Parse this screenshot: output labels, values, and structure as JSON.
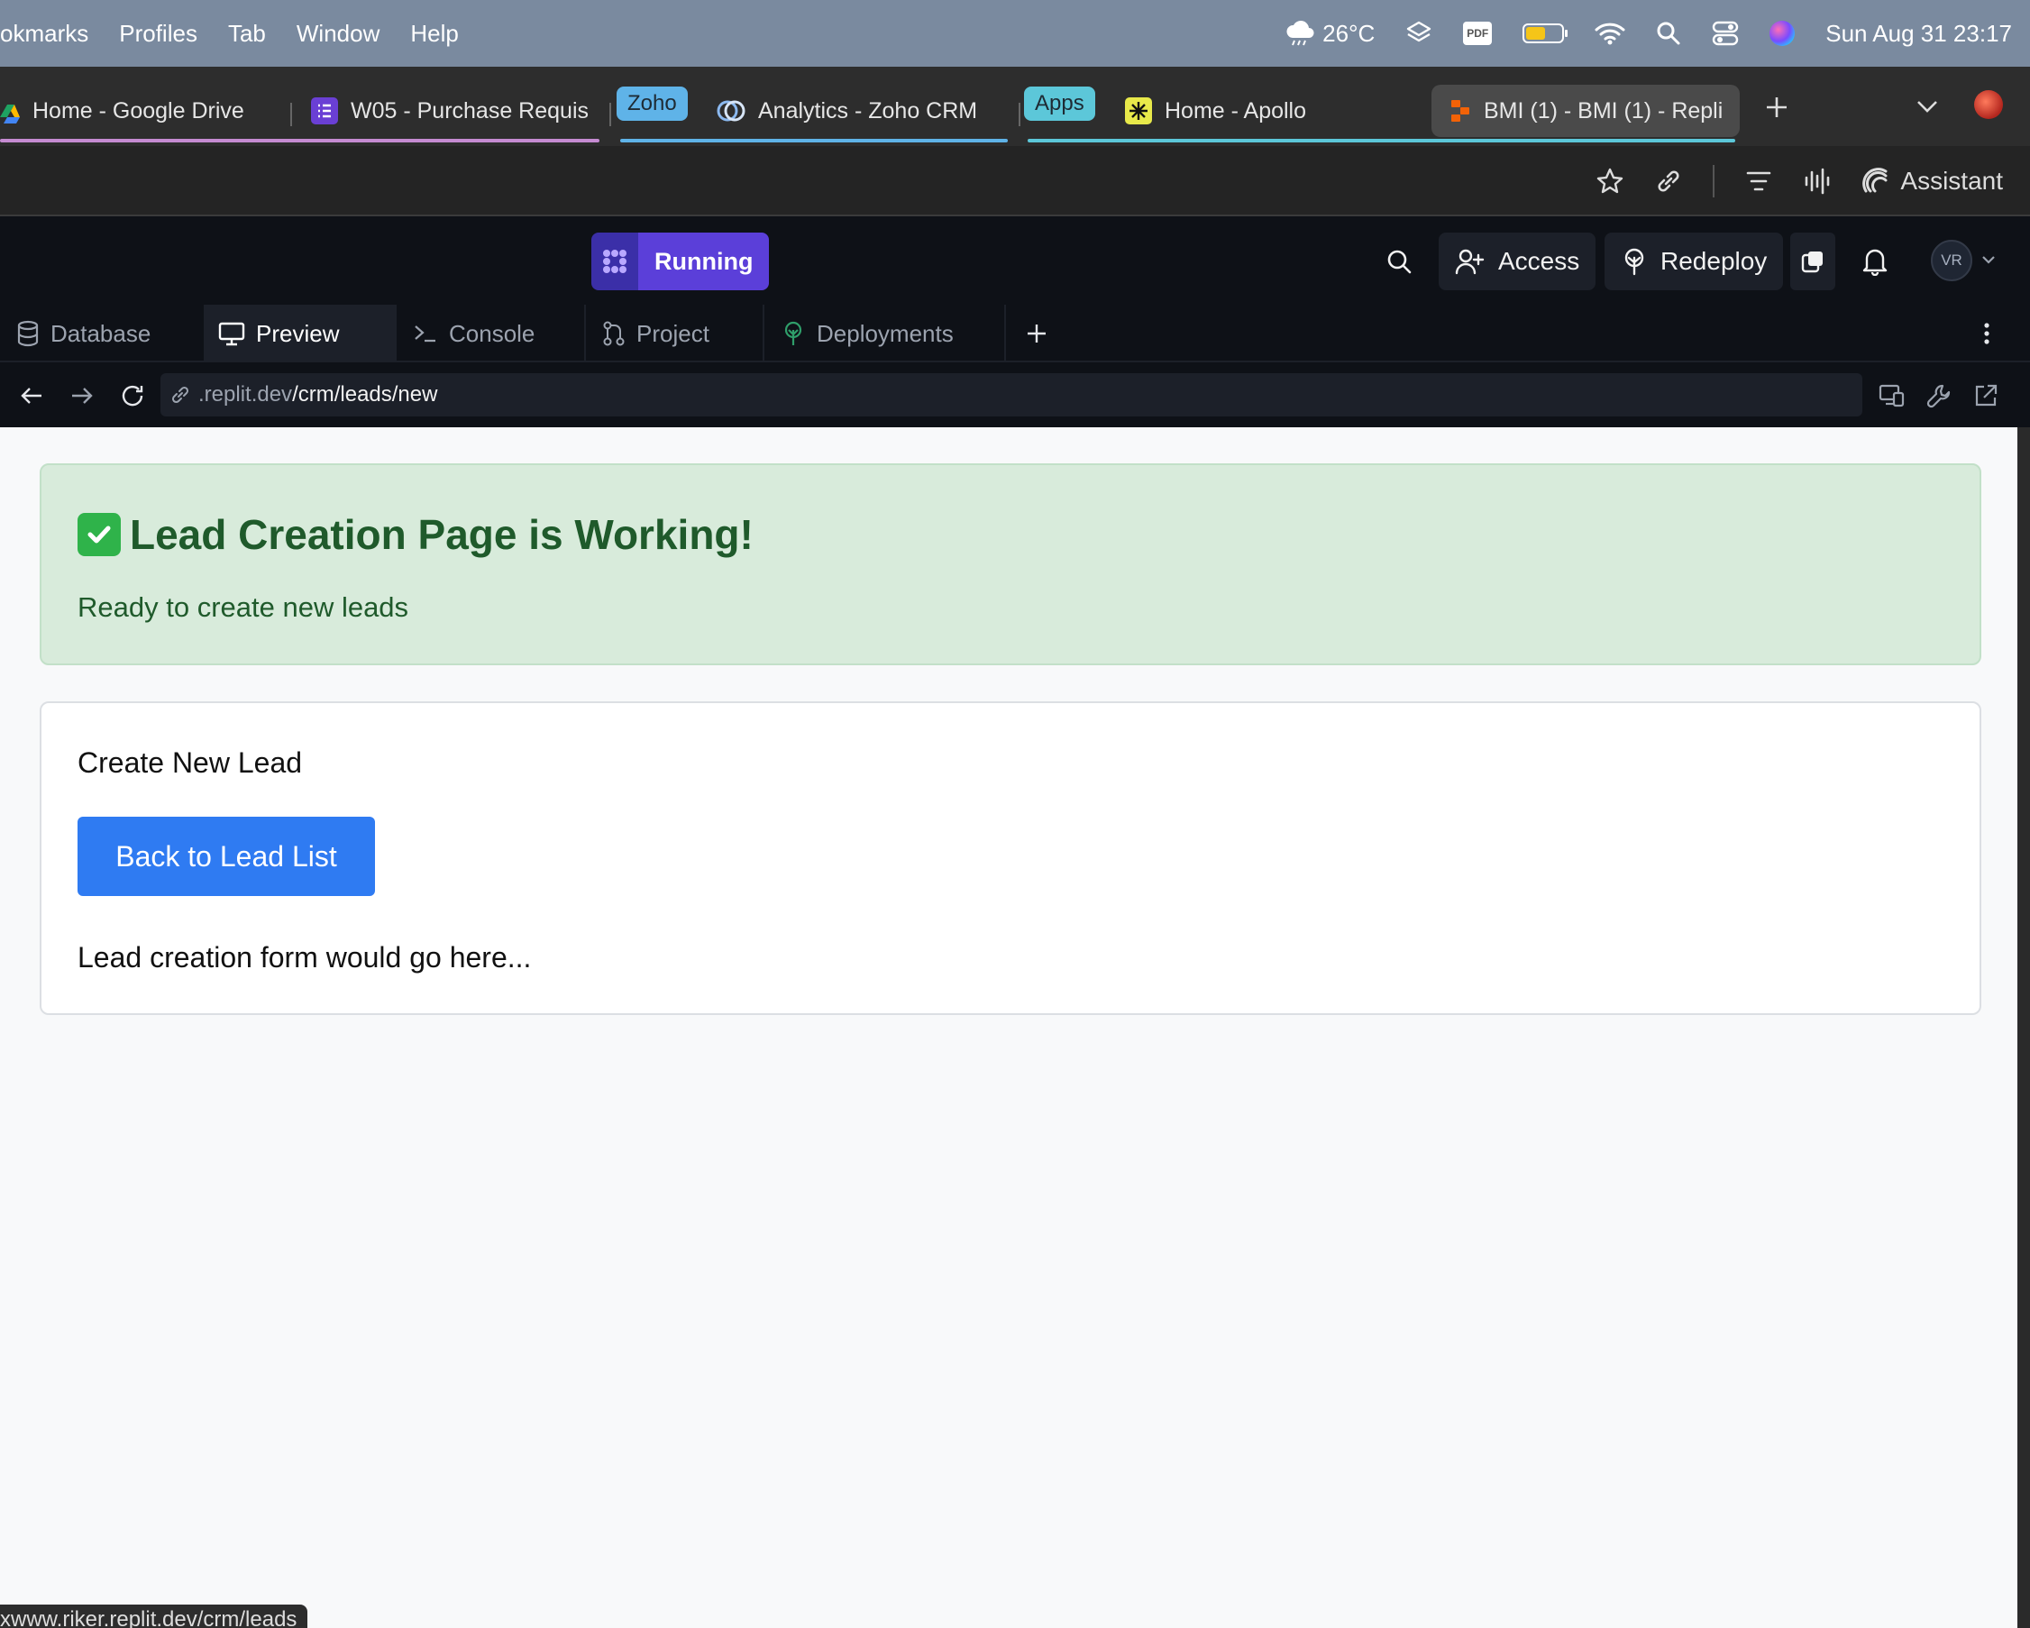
{
  "menubar": {
    "items": [
      "okmarks",
      "Profiles",
      "Tab",
      "Window",
      "Help"
    ],
    "weather": "26°C",
    "datetime": "Sun Aug 31  23:17",
    "pdf_badge": "PDF"
  },
  "browser_tabs": {
    "tabs": [
      {
        "title": "Home - Google Drive"
      },
      {
        "title": "W05 - Purchase Requis"
      },
      {
        "title": "Analytics - Zoho CRM"
      },
      {
        "title": "Home - Apollo"
      },
      {
        "title": "BMI (1) - BMI (1) - Repli"
      }
    ],
    "groups": [
      {
        "label": "Zoho",
        "color": "#5fb3e8"
      },
      {
        "label": "Apps",
        "color": "#5cc7d9"
      }
    ]
  },
  "toolbar": {
    "assistant_label": "Assistant"
  },
  "replit": {
    "status_label": "Running",
    "access_label": "Access",
    "redeploy_label": "Redeploy",
    "avatar_initials": "VR",
    "tabs": [
      {
        "label": "Database"
      },
      {
        "label": "Preview"
      },
      {
        "label": "Console"
      },
      {
        "label": "Project"
      },
      {
        "label": "Deployments"
      }
    ],
    "url_domain": ".replit.dev",
    "url_path": "/crm/leads/new"
  },
  "page": {
    "alert_title": "Lead Creation Page is Working!",
    "alert_subtitle": "Ready to create new leads",
    "card_heading": "Create New Lead",
    "back_button": "Back to Lead List",
    "placeholder_note": "Lead creation form would go here..."
  },
  "status_bar": {
    "hover_url": "xwww.riker.replit.dev/crm/leads"
  },
  "colors": {
    "accent": "#5b3fd9",
    "button": "#2f7bf2",
    "alert_bg": "#d8ebdb",
    "alert_text": "#1f5a2b"
  }
}
